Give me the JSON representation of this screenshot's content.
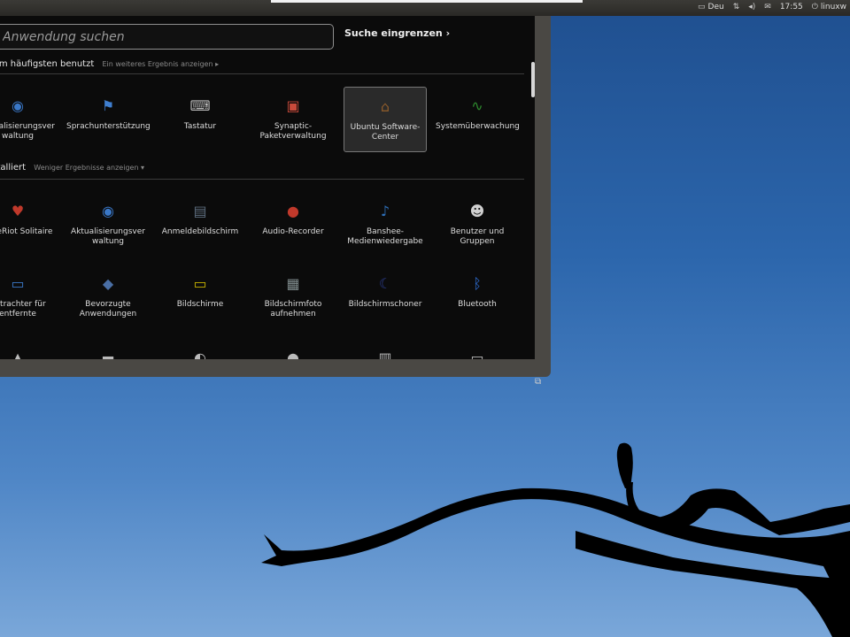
{
  "panel": {
    "keyboard": "Deu",
    "time": "17:55",
    "user": "linuxw"
  },
  "dash": {
    "search_placeholder": "Anwendung suchen",
    "filter_label": "Suche eingrenzen",
    "section_frequent": {
      "title": "Am häufigsten benutzt",
      "more": "Ein weiteres Ergebnis anzeigen"
    },
    "section_installed": {
      "title": "Installiert",
      "more": "Weniger Ergebnisse anzeigen"
    },
    "frequent_apps": [
      {
        "label": "Aktualisierungsver waltung",
        "icon": "globe-update-icon",
        "color": "#3a78c8"
      },
      {
        "label": "Sprachunterstützung",
        "icon": "flag-icon",
        "color": "#3f7fd0"
      },
      {
        "label": "Tastatur",
        "icon": "keyboard-icon",
        "color": "#bfbfbf"
      },
      {
        "label": "Synaptic-Paketverwaltung",
        "icon": "package-icon",
        "color": "#c94a3b"
      },
      {
        "label": "Ubuntu Software-Center",
        "icon": "software-center-icon",
        "color": "#8b5a2b"
      },
      {
        "label": "Systemüberwachung",
        "icon": "monitor-graph-icon",
        "color": "#2e8b2e"
      }
    ],
    "installed_apps": [
      {
        "label": "AisleRiot Solitaire",
        "icon": "cards-icon",
        "color": "#c0392b"
      },
      {
        "label": "Aktualisierungsver waltung",
        "icon": "globe-update-icon",
        "color": "#3a78c8"
      },
      {
        "label": "Anmeldebildschirm",
        "icon": "login-screen-icon",
        "color": "#5d6d7e"
      },
      {
        "label": "Audio-Recorder",
        "icon": "microphone-icon",
        "color": "#c0392b"
      },
      {
        "label": "Banshee-Medienwiedergabe",
        "icon": "banshee-icon",
        "color": "#2e6fb8"
      },
      {
        "label": "Benutzer und Gruppen",
        "icon": "users-icon",
        "color": "#d0d0d0"
      },
      {
        "label": "Betrachter für entfernte",
        "icon": "remote-desktop-icon",
        "color": "#3a78c8"
      },
      {
        "label": "Bevorzugte Anwendungen",
        "icon": "preferred-apps-icon",
        "color": "#4a6fa5"
      },
      {
        "label": "Bildschirme",
        "icon": "display-icon",
        "color": "#c8b400"
      },
      {
        "label": "Bildschirmfoto aufnehmen",
        "icon": "screenshot-icon",
        "color": "#7f8c8d"
      },
      {
        "label": "Bildschirmschoner",
        "icon": "screensaver-icon",
        "color": "#2c3e8f"
      },
      {
        "label": "Bluetooth",
        "icon": "bluetooth-icon",
        "color": "#2e6fd8"
      }
    ],
    "partial_row_icons": [
      "wizard-icon",
      "printer-icon",
      "disk-icon",
      "people-icon",
      "mug-icon",
      "window-icon"
    ]
  }
}
